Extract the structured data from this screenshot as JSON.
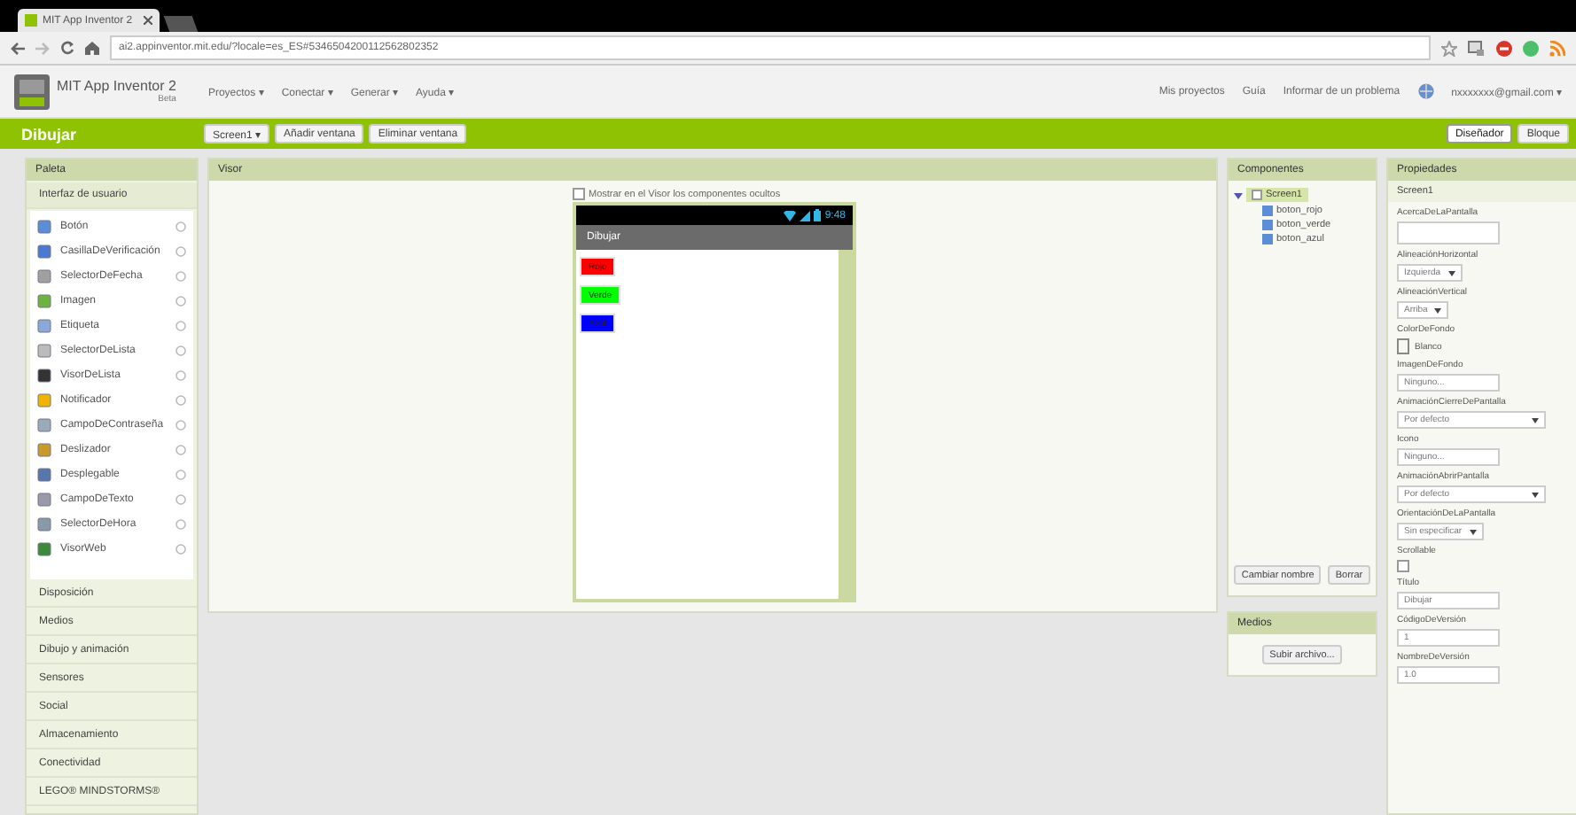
{
  "browser": {
    "tab_title": "MIT App Inventor 2",
    "url": "ai2.appinventor.mit.edu/?locale=es_ES#5346504200112562802352"
  },
  "header": {
    "app_name": "MIT App Inventor 2",
    "edition": "Beta",
    "menus": [
      "Proyectos ▾",
      "Conectar ▾",
      "Generar ▾",
      "Ayuda ▾"
    ],
    "links": [
      "Mis proyectos",
      "Guía",
      "Informar de un problema"
    ],
    "account": "nxxxxxxx@gmail.com ▾"
  },
  "toolbar": {
    "title": "Dibujar",
    "buttons": [
      "Screen1 ▾",
      "Añadir ventana",
      "Eliminar ventana"
    ],
    "view_buttons": [
      {
        "label": "Diseñador",
        "selected": true
      },
      {
        "label": "Bloque",
        "selected": false
      }
    ]
  },
  "palette": {
    "title": "Paleta",
    "groups": [
      {
        "label": "Interfaz de usuario",
        "expanded": true,
        "items": [
          "Botón",
          "CasillaDeVerificación",
          "SelectorDeFecha",
          "Imagen",
          "Etiqueta",
          "SelectorDeLista",
          "VisorDeLista",
          "Notificador",
          "CampoDeContraseña",
          "Deslizador",
          "Desplegable",
          "CampoDeTexto",
          "SelectorDeHora",
          "VisorWeb"
        ]
      },
      {
        "label": "Disposición",
        "expanded": false
      },
      {
        "label": "Medios",
        "expanded": false
      },
      {
        "label": "Dibujo y animación",
        "expanded": false
      },
      {
        "label": "Sensores",
        "expanded": false
      },
      {
        "label": "Social",
        "expanded": false
      },
      {
        "label": "Almacenamiento",
        "expanded": false
      },
      {
        "label": "Conectividad",
        "expanded": false
      },
      {
        "label": "LEGO® MINDSTORMS®",
        "expanded": false
      }
    ]
  },
  "viewer": {
    "title": "Visor",
    "show_hidden": {
      "label": "Mostrar en el Visor los componentes ocultos",
      "checked": false
    },
    "phone": {
      "time": "9:48",
      "title": "Dibujar",
      "buttons": [
        {
          "label": "Rojo",
          "color": "#ff0000"
        },
        {
          "label": "Verde",
          "color": "#00ff00"
        },
        {
          "label": "Azul",
          "color": "#0000ff"
        }
      ]
    }
  },
  "components": {
    "title": "Componentes",
    "tree": [
      {
        "label": "Screen1",
        "selected": true,
        "expanded": true,
        "children": [
          {
            "label": "boton_rojo"
          },
          {
            "label": "boton_verde"
          },
          {
            "label": "boton_azul"
          }
        ]
      }
    ],
    "buttons": [
      "Cambiar nombre",
      "Borrar"
    ]
  },
  "media": {
    "title": "Medios",
    "button": "Subir archivo..."
  },
  "properties": {
    "title": "Propiedades",
    "component": "Screen1",
    "items": [
      {
        "kind": "textarea",
        "label": "AcercaDeLaPantalla"
      },
      {
        "kind": "dropdown",
        "label": "AlineaciónHorizontal",
        "value": "Izquierda"
      },
      {
        "kind": "dropdown",
        "label": "AlineaciónVertical",
        "value": "Arriba"
      },
      {
        "kind": "color",
        "label": "ColorDeFondo",
        "value": "Blanco"
      },
      {
        "kind": "text",
        "label": "ImagenDeFondo",
        "value": "Ninguno..."
      },
      {
        "kind": "wide-dropdown",
        "label": "AnimaciónCierreDePantalla",
        "value": "Por defecto"
      },
      {
        "kind": "text",
        "label": "Icono",
        "value": "Ninguno..."
      },
      {
        "kind": "wide-dropdown",
        "label": "AnimaciónAbrirPantalla",
        "value": "Por defecto"
      },
      {
        "kind": "dropdown",
        "label": "OrientaciónDeLaPantalla",
        "value": "Sin especificar"
      },
      {
        "kind": "checkbox",
        "label": "Scrollable",
        "checked": false
      },
      {
        "kind": "text",
        "label": "Título",
        "value": "Dibujar"
      },
      {
        "kind": "text",
        "label": "CódigoDeVersión",
        "value": "1"
      },
      {
        "kind": "text",
        "label": "NombreDeVersión",
        "value": "1.0"
      }
    ]
  }
}
